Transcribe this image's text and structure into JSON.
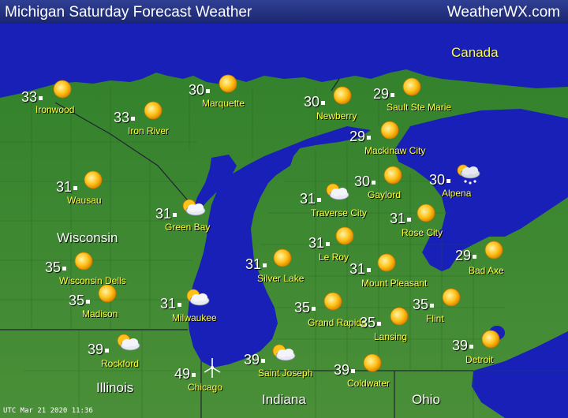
{
  "header": {
    "title": "Michigan Saturday Forecast Weather",
    "brand": "WeatherWX.com"
  },
  "regions": {
    "canada": "Canada",
    "wisconsin": "Wisconsin",
    "illinois": "Illinois",
    "indiana": "Indiana",
    "ohio": "Ohio"
  },
  "timestamp": "UTC Mar 21 2020 11:36",
  "colors": {
    "land": "#3d8a2e",
    "water": "#1820b8",
    "header": "#25318a",
    "city_label": "#ffff40"
  },
  "stations": [
    {
      "city": "Ironwood",
      "temp": "33",
      "icon": "sun-icon"
    },
    {
      "city": "Marquette",
      "temp": "30",
      "icon": "sun-icon"
    },
    {
      "city": "Iron River",
      "temp": "33",
      "icon": "sun-icon"
    },
    {
      "city": "Newberry",
      "temp": "30",
      "icon": "sun-icon"
    },
    {
      "city": "Sault Ste Marie",
      "temp": "29",
      "icon": "sun-icon"
    },
    {
      "city": "Mackinaw City",
      "temp": "29",
      "icon": "sun-icon"
    },
    {
      "city": "Gaylord",
      "temp": "30",
      "icon": "sun-icon"
    },
    {
      "city": "Alpena",
      "temp": "30",
      "icon": "snow-cloud-icon"
    },
    {
      "city": "Wausau",
      "temp": "31",
      "icon": "sun-icon"
    },
    {
      "city": "Traverse City",
      "temp": "31",
      "icon": "partly-cloudy-icon"
    },
    {
      "city": "Green Bay",
      "temp": "31",
      "icon": "partly-cloudy-icon"
    },
    {
      "city": "Rose City",
      "temp": "31",
      "icon": "sun-icon"
    },
    {
      "city": "Le Roy",
      "temp": "31",
      "icon": "sun-icon"
    },
    {
      "city": "Wisconsin Dells",
      "temp": "35",
      "icon": "sun-icon"
    },
    {
      "city": "Silver Lake",
      "temp": "31",
      "icon": "sun-icon"
    },
    {
      "city": "Mount Pleasant",
      "temp": "31",
      "icon": "sun-icon"
    },
    {
      "city": "Bad Axe",
      "temp": "29",
      "icon": "sun-icon"
    },
    {
      "city": "Madison",
      "temp": "35",
      "icon": "sun-icon"
    },
    {
      "city": "Milwaukee",
      "temp": "31",
      "icon": "partly-cloudy-icon"
    },
    {
      "city": "Grand Rapids",
      "temp": "35",
      "icon": "sun-icon"
    },
    {
      "city": "Flint",
      "temp": "35",
      "icon": "sun-icon"
    },
    {
      "city": "Lansing",
      "temp": "35",
      "icon": "sun-icon"
    },
    {
      "city": "Rockford",
      "temp": "39",
      "icon": "partly-cloudy-icon"
    },
    {
      "city": "Detroit",
      "temp": "39",
      "icon": "sun-icon"
    },
    {
      "city": "Saint Joseph",
      "temp": "39",
      "icon": "partly-cloudy-icon"
    },
    {
      "city": "Chicago",
      "temp": "49",
      "icon": "wind-icon"
    },
    {
      "city": "Coldwater",
      "temp": "39",
      "icon": "sun-icon"
    }
  ]
}
